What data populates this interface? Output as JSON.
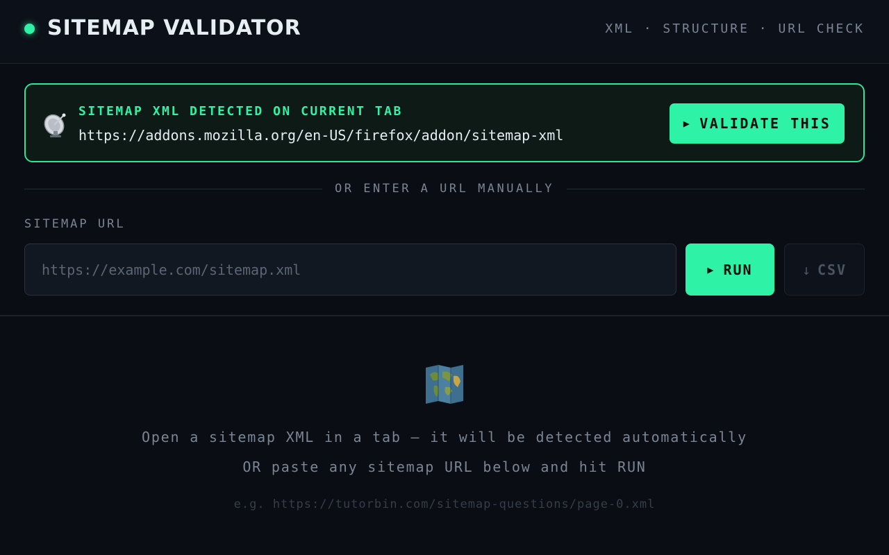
{
  "header": {
    "title": "SITEMAP VALIDATOR",
    "tagline": "XML · STRUCTURE · URL CHECK",
    "status_color": "#2ef2a5"
  },
  "detected": {
    "icon": "satellite-dish-icon",
    "title": "SITEMAP XML DETECTED ON CURRENT TAB",
    "url": "https://addons.mozilla.org/en-US/firefox/addon/sitemap-xml-…",
    "button_label": "VALIDATE THIS",
    "button_icon": "play-icon"
  },
  "divider": {
    "text": "OR ENTER A URL MANUALLY"
  },
  "form": {
    "label": "SITEMAP URL",
    "value": "",
    "placeholder": "https://example.com/sitemap.xml",
    "run_label": "RUN",
    "run_icon": "play-icon",
    "csv_label": "CSV",
    "csv_icon": "download-arrow-icon",
    "csv_enabled": false
  },
  "empty_state": {
    "icon": "world-map-icon",
    "line1": "Open a sitemap XML in a tab — it will be detected automatically",
    "line2": "OR paste any sitemap URL below and hit RUN",
    "example": "e.g. https://tutorbin.com/sitemap-questions/page-0.xml"
  },
  "colors": {
    "accent": "#2ef2a5",
    "background": "#0a0d13",
    "muted_text": "#7b8594"
  }
}
